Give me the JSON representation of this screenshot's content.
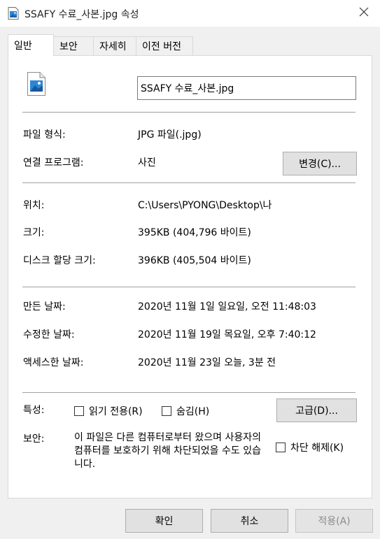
{
  "window": {
    "title": "SSAFY 수료_사본.jpg 속성",
    "close_icon": "close-icon",
    "title_icon": "image-file-icon"
  },
  "tabs": [
    "일반",
    "보안",
    "자세히",
    "이전 버전"
  ],
  "active_tab": "일반",
  "general": {
    "file_icon": "image-file-icon",
    "filename": "SSAFY 수료_사본.jpg",
    "type_label": "파일 형식:",
    "type_value": "JPG 파일(.jpg)",
    "opens_with_label": "연결 프로그램:",
    "opens_with_value": "사진",
    "change_button": "변경(C)...",
    "location_label": "위치:",
    "location_value": "C:\\Users\\PYONG\\Desktop\\나",
    "size_label": "크기:",
    "size_value": "395KB (404,796 바이트)",
    "disk_size_label": "디스크 할당 크기:",
    "disk_size_value": "396KB (405,504 바이트)",
    "created_label": "만든 날짜:",
    "created_value": "2020년 11월 1일 일요일, 오전 11:48:03",
    "modified_label": "수정한 날짜:",
    "modified_value": "2020년 11월 19일 목요일, 오후 7:40:12",
    "accessed_label": "액세스한 날짜:",
    "accessed_value": "2020년 11월 23일 오늘, 3분 전",
    "attributes_label": "특성:",
    "readonly_label": "읽기 전용(R)",
    "hidden_label": "숨김(H)",
    "advanced_button": "고급(D)...",
    "security_label": "보안:",
    "security_text": "이 파일은 다른 컴퓨터로부터 왔으며 사용자의 컴퓨터를 보호하기 위해 차단되었을 수도 있습니다.",
    "unblock_label": "차단 해제(K)",
    "readonly_checked": false,
    "hidden_checked": false,
    "unblock_checked": false
  },
  "footer": {
    "ok": "확인",
    "cancel": "취소",
    "apply": "적용(A)"
  },
  "colors": {
    "window_bg": "#f0f0f0",
    "panel_bg": "#ffffff",
    "button_bg": "#e1e1e1",
    "disabled_text": "#8a8a8a"
  }
}
